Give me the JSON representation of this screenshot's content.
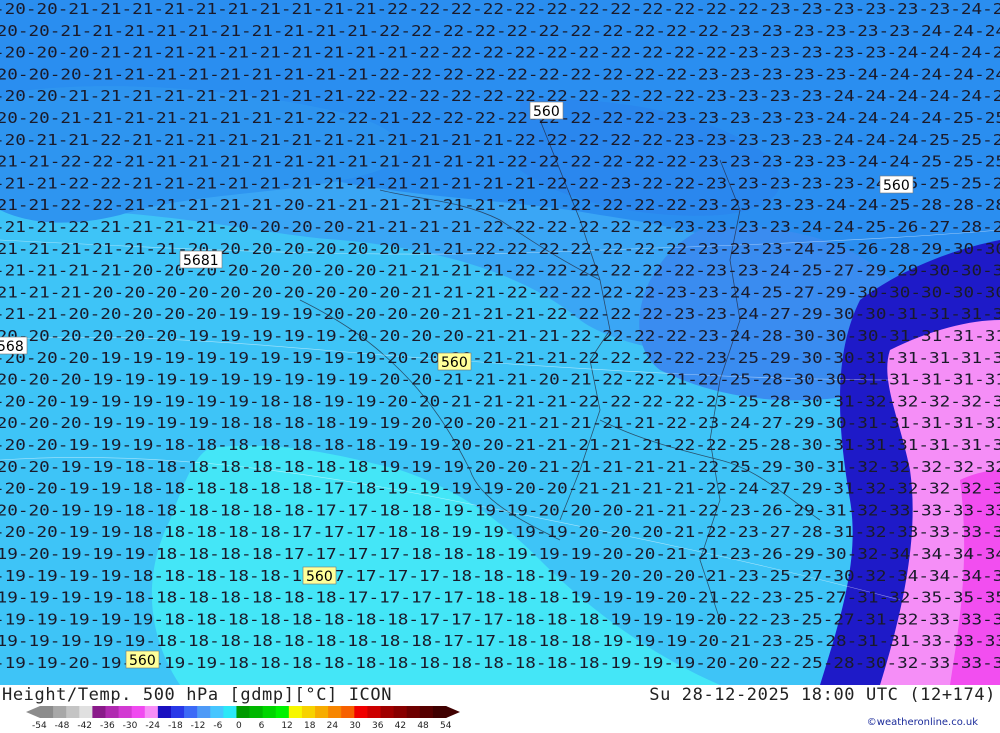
{
  "header": {
    "title_left": "Height/Temp. 500 hPa [gdmp][°C] ICON",
    "title_right": "Su 28-12-2025 18:00 UTC (12+174)",
    "credit": "©weatheronline.co.uk"
  },
  "map": {
    "height_labels": [
      "560",
      "5681",
      "568",
      "560",
      "560",
      "560",
      "560"
    ],
    "temperature_rows": [
      {
        "temp_start": -20,
        "text": "-20-20-21-21-21-21-21-21-21-21-21-21-22-22-22-22-22-22-22-22-22-22-22-22-23-23-23-23-23-23-24-24"
      },
      {
        "text": "-20-20-21-21-21-21-21-21-21-21-21-21-22-22-22-22-22-22-22-22-22-22-22-23-23-23-23-23-23-24-24-24"
      },
      {
        "text": "-20-20-20-21-21-21-21-21-21-21-21-21-21-22-22-22-22-22-22-22-22-22-22-23-23-23-23-23-24-24-24-24"
      },
      {
        "text": "-20-20-20-21-21-21-21-21-21-21-21-21-22-22-22-22-22-22-22-22-22-22-23-23-23-23-23-24-24-24-24-24"
      },
      {
        "text": "-20-20-21-21-21-21-21-21-21-21-21-22-22-22-22-22-22-22-22-22-22-22-23-23-23-23-24-24-24-24-24-25"
      },
      {
        "text": "-20-20-21-21-21-21-21-21-21-21-22-22-21-22-22-22-22-22-22-22-22-23-23-23-23-23-24-24-24-24-25-25"
      },
      {
        "text": "-20-21-21-22-21-21-21-21-21-21-21-21-21-21-21-21-22-22-22-22-22-23-23-23-23-23-24-24-24-25-25-25"
      },
      {
        "text": "-21-21-22-22-21-21-21-21-21-21-21-21-21-21-21-21-22-22-22-22-22-22-23-23-23-23-23-24-24-25-25-25"
      },
      {
        "text": "-21-21-22-22-21-21-21-21-21-21-21-21-21-21-21-21-21-22-22-23-22-22-23-23-23-23-23-24-25-25-25-25"
      },
      {
        "text": "-21-21-22-22-21-21-21-21-21-20-21-21-21-21-21-21-21-21-22-22-22-22-23-23-23-23-24-24-25-28-28-28"
      },
      {
        "text": "-21-21-22-21-21-21-21-20-20-20-20-21-21-21-21-22-22-22-22-22-22-23-23-23-23-24-24-25-26-27-28-29"
      },
      {
        "text": "-21-21-21-21-21-21-20-20-20-20-20-20-20-21-21-22-22-22-22-22-22-22-23-23-23-24-25-26-28-29-30-30"
      },
      {
        "text": "-21-21-21-21-20-20-20-20-20-20-20-20-21-21-21-21-22-22-22-22-22-22-23-23-24-25-27-29-29-30-30-30"
      },
      {
        "text": "-21-21-21-20-20-20-20-20-20-20-20-20-20-21-21-21-22-22-22-22-22-23-23-24-25-27-29-30-30-30-30-30"
      },
      {
        "text": "-21-21-20-20-20-20-20-19-19-19-20-20-20-20-21-21-21-22-22-22-22-23-23-24-27-29-30-30-31-31-31-31"
      },
      {
        "text": "-20-20-20-20-20-20-19-19-19-19-19-20-20-20-20-21-21-21-22-22-22-22-23-24-28-30-30-30-31-31-31-31"
      },
      {
        "text": "-20-20-20-19-19-19-19-19-19-19-19-19-20-20-20-21-21-21-22-22-22-22-23-25-29-30-30-31-31-31-31-31"
      },
      {
        "text": "-20-20-20-19-19-19-19-19-19-19-19-19-20-20-21-21-21-20-21-22-22-21-22-25-28-30-30-31-31-31-31-31"
      },
      {
        "text": "-20-20-19-19-19-19-19-19-18-18-19-19-20-20-21-21-21-21-22-22-22-22-23-25-28-30-31-32-32-32-32-32"
      },
      {
        "text": "-20-20-20-19-19-19-19-18-18-18-18-19-19-20-20-20-21-21-21-21-21-22-23-24-27-29-30-31-31-31-31-31"
      },
      {
        "text": "-20-20-19-19-19-18-18-18-18-18-18-18-19-19-20-20-21-21-21-21-21-22-22-25-28-30-31-31-31-31-31-31"
      },
      {
        "text": "-20-20-19-19-18-18-18-18-18-18-18-18-19-19-19-20-20-21-21-21-21-21-22-25-29-30-31-32-32-32-32-32"
      },
      {
        "text": "-20-20-19-19-18-18-18-18-18-18-17-18-19-19-19-19-20-20-21-21-21-21-22-24-27-29-31-32-32-32-32-32"
      },
      {
        "text": "-20-20-19-19-18-18-18-18-18-18-17-17-18-18-19-19-19-20-20-20-21-21-22-23-26-29-31-32-33-33-33-33"
      },
      {
        "text": "-20-20-19-19-18-18-18-18-18-17-17-17-18-18-19-19-19-19-20-20-20-21-22-23-27-28-31-32-33-33-33-33"
      },
      {
        "text": "-19-20-19-19-19-18-18-18-18-17-17-17-17-18-18-18-19-19-19-20-20-21-21-23-26-29-30-32-34-34-34-34"
      },
      {
        "text": "-19-19-19-19-18-18-18-18-18-18-17-17-17-17-18-18-18-19-19-20-20-20-21-23-25-27-30-32-34-34-34-34"
      },
      {
        "text": "-19-19-19-19-18-18-18-18-18-18-18-17-17-17-17-18-18-18-19-19-19-20-21-22-23-25-27-31-32-35-35-35"
      },
      {
        "text": "-19-19-19-19-19-18-18-18-18-18-18-18-18-17-17-17-18-18-18-19-19-19-20-22-23-25-27-31-32-33-33-33"
      },
      {
        "text": "-19-19-19-19-19-18-18-18-18-18-18-18-18-18-17-17-18-18-18-19-19-19-20-21-23-25-28-31-31-33-33-33"
      },
      {
        "text": "-19-19-20-19-19-19-19-18-18-18-18-18-18-18-18-18-18-18-18-19-19-19-20-20-22-25-28-30-32-33-33-33"
      }
    ]
  },
  "legend": {
    "tick_labels": [
      "-54",
      "-48",
      "-42",
      "-36",
      "-30",
      "-24",
      "-18",
      "-12",
      "-6",
      "0",
      "6",
      "12",
      "18",
      "24",
      "30",
      "36",
      "42",
      "48",
      "54"
    ],
    "colors": [
      "#8c8c8c",
      "#a8a8a8",
      "#c4c4c4",
      "#e0e0e0",
      "#8a1a8a",
      "#b02ab0",
      "#d23ad2",
      "#f04af0",
      "#f78ef7",
      "#1a10c0",
      "#2838e8",
      "#3c6af7",
      "#4e9af7",
      "#46c6ff",
      "#2ce8f7",
      "#009a00",
      "#00b800",
      "#00d600",
      "#00f200",
      "#f7f700",
      "#f7d200",
      "#f7ac00",
      "#f78600",
      "#f76000",
      "#f00000",
      "#cc0000",
      "#a00000",
      "#880000",
      "#6e0000",
      "#560000",
      "#400000"
    ]
  }
}
